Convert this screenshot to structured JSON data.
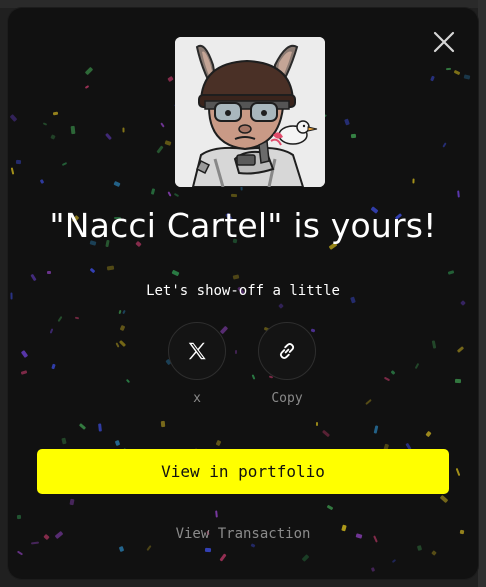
{
  "modal": {
    "title": "\"Nacci Cartel\" is yours!",
    "subtitle": "Let's show-off a little",
    "share": {
      "x_label": "x",
      "copy_label": "Copy"
    },
    "primary_button": "View in portfolio",
    "secondary_link": "View Transaction"
  },
  "icons": {
    "close": "close-icon",
    "x": "x-logo-icon",
    "copy": "link-icon",
    "nft": "nft-artwork"
  },
  "colors": {
    "accent": "#ffff00",
    "modal_bg": "#111111",
    "text": "#ffffff",
    "muted": "#8a8a8a"
  }
}
